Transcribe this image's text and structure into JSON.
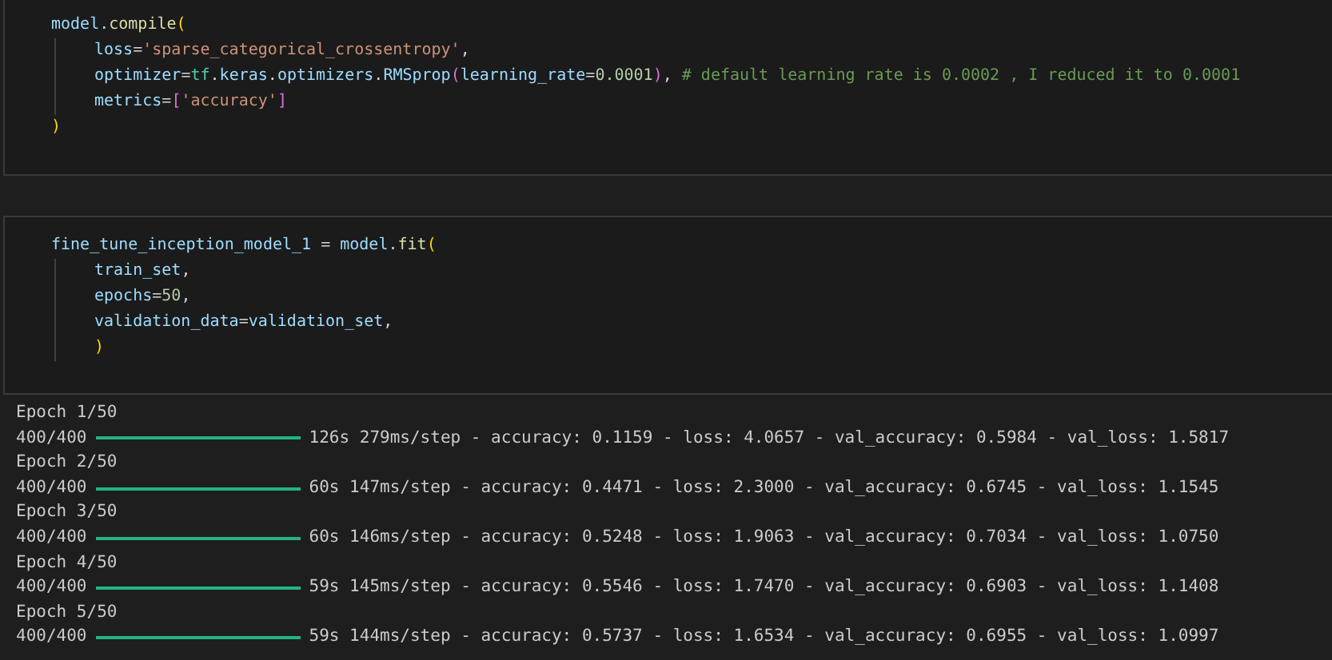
{
  "cells": [
    {
      "kind": "code",
      "lines": [
        {
          "indent": false,
          "tokens": [
            {
              "text": "model.",
              "kind": "var"
            },
            {
              "text": "compile",
              "kind": "fn"
            },
            {
              "text": "(",
              "kind": "bracket1"
            }
          ]
        },
        {
          "indent": true,
          "tokens": [
            {
              "text": "loss",
              "kind": "var"
            },
            {
              "text": "=",
              "kind": "plain"
            },
            {
              "text": "'sparse_categorical_crossentropy'",
              "kind": "str"
            },
            {
              "text": ",",
              "kind": "plain"
            }
          ]
        },
        {
          "indent": true,
          "tokens": [
            {
              "text": "optimizer",
              "kind": "var"
            },
            {
              "text": "=",
              "kind": "plain"
            },
            {
              "text": "tf",
              "kind": "type"
            },
            {
              "text": ".",
              "kind": "plain"
            },
            {
              "text": "keras",
              "kind": "var"
            },
            {
              "text": ".",
              "kind": "plain"
            },
            {
              "text": "optimizers",
              "kind": "var"
            },
            {
              "text": ".",
              "kind": "plain"
            },
            {
              "text": "RMSprop",
              "kind": "var"
            },
            {
              "text": "(",
              "kind": "bracket2"
            },
            {
              "text": "learning_rate",
              "kind": "var"
            },
            {
              "text": "=",
              "kind": "plain"
            },
            {
              "text": "0.0001",
              "kind": "num"
            },
            {
              "text": ")",
              "kind": "bracket2"
            },
            {
              "text": ",",
              "kind": "plain"
            },
            {
              "text": " # default learning rate is 0.0002 , I reduced it to 0.0001",
              "kind": "comment"
            }
          ]
        },
        {
          "indent": true,
          "tokens": [
            {
              "text": "metrics",
              "kind": "var"
            },
            {
              "text": "=",
              "kind": "plain"
            },
            {
              "text": "[",
              "kind": "bracket2"
            },
            {
              "text": "'accuracy'",
              "kind": "str"
            },
            {
              "text": "]",
              "kind": "bracket2"
            }
          ]
        },
        {
          "indent": false,
          "tokens": [
            {
              "text": ")",
              "kind": "bracket1"
            }
          ]
        }
      ]
    },
    {
      "kind": "code",
      "lines": [
        {
          "indent": false,
          "tokens": [
            {
              "text": "fine_tune_inception_model_1",
              "kind": "var"
            },
            {
              "text": " = ",
              "kind": "plain"
            },
            {
              "text": "model",
              "kind": "var"
            },
            {
              "text": ".",
              "kind": "plain"
            },
            {
              "text": "fit",
              "kind": "fn"
            },
            {
              "text": "(",
              "kind": "bracket1"
            }
          ]
        },
        {
          "indent": true,
          "tokens": [
            {
              "text": "train_set",
              "kind": "var"
            },
            {
              "text": ",",
              "kind": "plain"
            }
          ]
        },
        {
          "indent": true,
          "tokens": [
            {
              "text": "epochs",
              "kind": "var"
            },
            {
              "text": "=",
              "kind": "plain"
            },
            {
              "text": "50",
              "kind": "num"
            },
            {
              "text": ",",
              "kind": "plain"
            }
          ]
        },
        {
          "indent": true,
          "tokens": [
            {
              "text": "validation_data",
              "kind": "var"
            },
            {
              "text": "=",
              "kind": "plain"
            },
            {
              "text": "validation_set",
              "kind": "var"
            },
            {
              "text": ",",
              "kind": "plain"
            }
          ]
        },
        {
          "indent": true,
          "tokens": [
            {
              "text": ")",
              "kind": "bracket1"
            }
          ]
        }
      ]
    }
  ],
  "output": [
    {
      "kind": "epoch",
      "text": "Epoch 1/50"
    },
    {
      "kind": "progress",
      "count": "400/400",
      "level": 1,
      "stats": "126s 279ms/step - accuracy: 0.1159 - loss: 4.0657 - val_accuracy: 0.5984 - val_loss: 1.5817"
    },
    {
      "kind": "epoch",
      "text": "Epoch 2/50"
    },
    {
      "kind": "progress",
      "count": "400/400",
      "level": 1,
      "stats": "60s 147ms/step - accuracy: 0.4471 - loss: 2.3000 - val_accuracy: 0.6745 - val_loss: 1.1545"
    },
    {
      "kind": "epoch",
      "text": "Epoch 3/50"
    },
    {
      "kind": "progress",
      "count": "400/400",
      "level": 1,
      "stats": "60s 146ms/step - accuracy: 0.5248 - loss: 1.9063 - val_accuracy: 0.7034 - val_loss: 1.0750"
    },
    {
      "kind": "epoch",
      "text": "Epoch 4/50"
    },
    {
      "kind": "progress",
      "count": "400/400",
      "level": 1,
      "stats": "59s 145ms/step - accuracy: 0.5546 - loss: 1.7470 - val_accuracy: 0.6903 - val_loss: 1.1408"
    },
    {
      "kind": "epoch",
      "text": "Epoch 5/50"
    },
    {
      "kind": "progress",
      "count": "400/400",
      "level": 1,
      "stats": "59s 144ms/step - accuracy: 0.5737 - loss: 1.6534 - val_accuracy: 0.6955 - val_loss: 1.0997"
    }
  ]
}
